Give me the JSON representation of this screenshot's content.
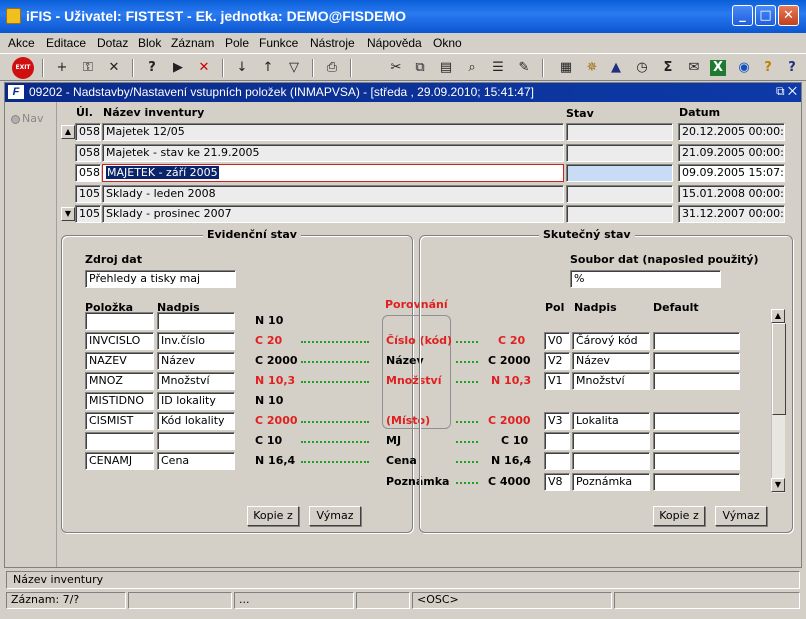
{
  "window": {
    "title": "iFIS - Uživatel: FISTEST - Ek. jednotka: DEMO@FISDEMO",
    "min": "_",
    "max": "□",
    "close": "✕"
  },
  "menu": [
    "Akce",
    "Editace",
    "Dotaz",
    "Blok",
    "Záznam",
    "Pole",
    "Funkce",
    "Nástroje",
    "Nápověda",
    "Okno"
  ],
  "toolbar": {
    "exit_label": "EXIT",
    "icons": [
      "exit-icon",
      "insert-record-icon",
      "lock-icon",
      "delete-record-icon",
      "enter-query-icon",
      "execute-query-icon",
      "cancel-query-icon",
      "sort-ascending-icon",
      "sort-descending-icon",
      "filter-icon",
      "print-icon",
      "cut-icon",
      "copy-icon",
      "paste-icon",
      "search-icon",
      "list-icon",
      "edit-icon",
      "calculator-icon",
      "wheel-icon",
      "triangle-icon",
      "clock-icon",
      "sum-icon",
      "mail-icon",
      "excel-icon",
      "web-icon",
      "help-icon",
      "context-help-icon"
    ],
    "glyphs": [
      "",
      "+",
      "⚿",
      "✕",
      "?",
      "▶",
      "✕",
      "↓",
      "↑",
      "▽",
      "⎙",
      "✂",
      "⧉",
      "▤",
      "⌕",
      "☰",
      "✎",
      "▦",
      "✵",
      "▲",
      "◷",
      "Σ",
      "✉",
      "X",
      "◉",
      "?",
      "?"
    ]
  },
  "form": {
    "title": "09202 - Nadstavby/Nastavení vstupních položek (INMAPVSA) - [středa , 29.09.2010; 15:41:47]",
    "icon": "F",
    "ctrl": "⧉ ✕",
    "nav_label": "Nav"
  },
  "table": {
    "headers": {
      "ul": "Úl.",
      "name": "Název inventury",
      "stav": "Stav",
      "datum": "Datum"
    },
    "rows": [
      {
        "ul": "058",
        "name": "Majetek 12/05",
        "stav": "",
        "datum": "20.12.2005 00:00:00"
      },
      {
        "ul": "058",
        "name": "Majetek - stav ke 21.9.2005",
        "stav": "",
        "datum": "21.09.2005 00:00:00"
      },
      {
        "ul": "058",
        "name": "MAJETEK - září 2005",
        "stav": "",
        "datum": "09.09.2005 15:07:14"
      },
      {
        "ul": "105",
        "name": "Sklady - leden 2008",
        "stav": "",
        "datum": "15.01.2008 00:00:00"
      },
      {
        "ul": "105",
        "name": "Sklady - prosinec 2007",
        "stav": "",
        "datum": "31.12.2007 00:00:00"
      }
    ],
    "selected_row": 2
  },
  "evidencni": {
    "title": "Evidenční stav",
    "zdroj_label": "Zdroj dat",
    "zdroj_value": "Přehledy a tisky maj",
    "col_polozka": "Položka",
    "col_nadpis": "Nadpis",
    "rows": [
      {
        "polozka": "",
        "nadpis": "",
        "type": "N 10",
        "red": false
      },
      {
        "polozka": "INVCISLO",
        "nadpis": "Inv.číslo",
        "type": "C 20",
        "red": true
      },
      {
        "polozka": "NAZEV",
        "nadpis": "Název",
        "type": "C 2000",
        "red": false
      },
      {
        "polozka": "MNOZ",
        "nadpis": "Množství",
        "type": "N 10,3",
        "red": true
      },
      {
        "polozka": "MISTIDNO",
        "nadpis": "ID lokality",
        "type": "N 10",
        "red": false
      },
      {
        "polozka": "CISMIST",
        "nadpis": "Kód lokality",
        "type": "C 2000",
        "red": true
      },
      {
        "polozka": "",
        "nadpis": "",
        "type": "C 10",
        "red": false
      },
      {
        "polozka": "CENAMJ",
        "nadpis": "Cena",
        "type": "N 16,4",
        "red": false
      }
    ],
    "kopie": "Kopie z",
    "vymaz": "Výmaz"
  },
  "porovnani": {
    "title": "Porovnání",
    "rows": [
      {
        "label": "",
        "type": "",
        "red": false
      },
      {
        "label": "Číslo (kód)",
        "type": "C 20",
        "red": true
      },
      {
        "label": "Název",
        "type": "C 2000",
        "red": false
      },
      {
        "label": "Množství",
        "type": "N 10,3",
        "red": true
      },
      {
        "label": "",
        "type": "",
        "red": false
      },
      {
        "label": "(Místo)",
        "type": "C 2000",
        "red": true
      },
      {
        "label": "MJ",
        "type": "C 10",
        "red": false
      },
      {
        "label": "Cena",
        "type": "N 16,4",
        "red": false
      },
      {
        "label": "Poznámka",
        "type": "C 4000",
        "red": false
      }
    ]
  },
  "skutecny": {
    "title": "Skutečný stav",
    "soubor_label": "Soubor dat (naposled použitý)",
    "soubor_value": "%",
    "col_pol": "Pol",
    "col_nadpis": "Nadpis",
    "col_default": "Default",
    "rows": [
      {
        "pol": "V0",
        "nadpis": "Čárový kód",
        "default": ""
      },
      {
        "pol": "V2",
        "nadpis": "Název",
        "default": ""
      },
      {
        "pol": "V1",
        "nadpis": "Množství",
        "default": ""
      },
      {
        "pol": "V3",
        "nadpis": "Lokalita",
        "default": ""
      },
      {
        "pol": "",
        "nadpis": "",
        "default": ""
      },
      {
        "pol": "",
        "nadpis": "",
        "default": ""
      },
      {
        "pol": "V8",
        "nadpis": "Poznámka",
        "default": ""
      }
    ],
    "kopie": "Kopie z",
    "vymaz": "Výmaz"
  },
  "status": {
    "hint": "Název inventury",
    "record": "Záznam: 7/?",
    "ellipsis": "...",
    "mode": "<OSC>"
  }
}
